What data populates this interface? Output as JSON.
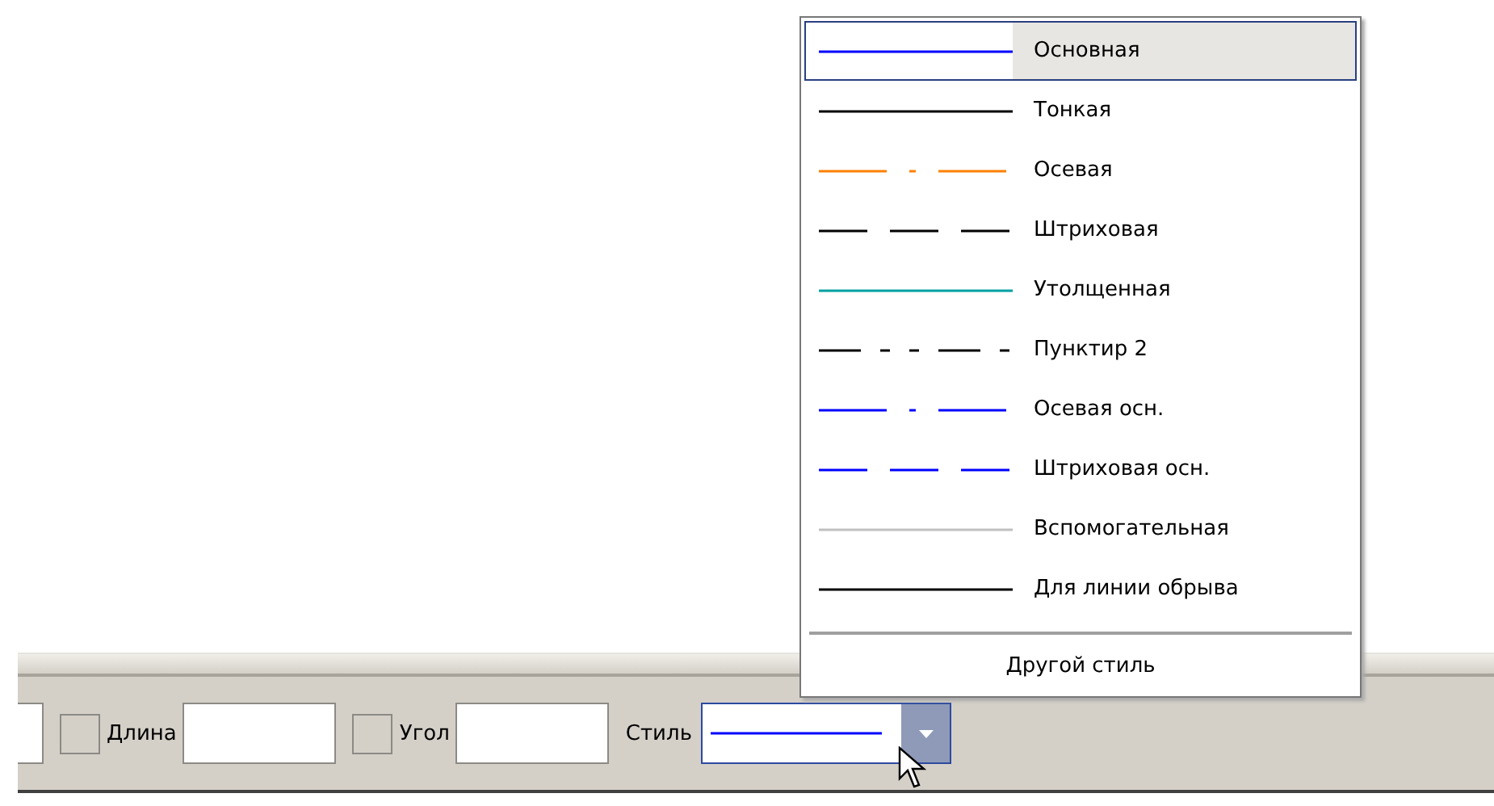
{
  "toolbar": {
    "fields": [
      {
        "kind": "cut"
      },
      {
        "kind": "field",
        "label": "Длина",
        "checked": false
      },
      {
        "kind": "field",
        "label": "Угол",
        "checked": false
      }
    ],
    "style_label": "Стиль",
    "style_combo": {
      "color": "#0000ff",
      "kind": "solid"
    }
  },
  "dropdown": {
    "items": [
      {
        "label": "Основная",
        "kind": "solid",
        "color": "#0000ff",
        "selected": true
      },
      {
        "label": "Тонкая",
        "kind": "solid",
        "color": "#000000",
        "selected": false
      },
      {
        "label": "Осевая",
        "kind": "dashdot",
        "color": "#ff8000",
        "selected": false
      },
      {
        "label": "Штриховая",
        "kind": "dashed",
        "color": "#000000",
        "selected": false
      },
      {
        "label": "Утолщенная",
        "kind": "solid",
        "color": "#00a0a0",
        "selected": false
      },
      {
        "label": "Пунктир 2",
        "kind": "dashdotdot",
        "color": "#000000",
        "selected": false
      },
      {
        "label": "Осевая осн.",
        "kind": "dashdot",
        "color": "#0000ff",
        "selected": false
      },
      {
        "label": "Штриховая осн.",
        "kind": "dashed",
        "color": "#0000ff",
        "selected": false
      },
      {
        "label": "Вспомогательная",
        "kind": "solid",
        "color": "#c0c0c0",
        "selected": false
      },
      {
        "label": "Для линии обрыва",
        "kind": "solid",
        "color": "#000000",
        "selected": false
      }
    ],
    "other": "Другой стиль"
  }
}
